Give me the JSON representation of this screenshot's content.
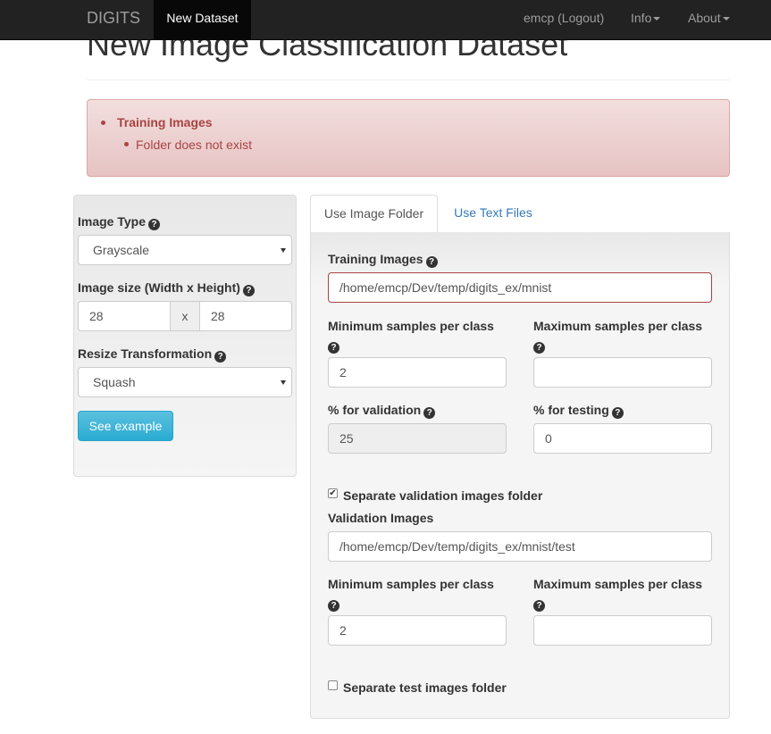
{
  "navbar": {
    "brand": "DIGITS",
    "active_item": "New Dataset",
    "user_link": "emcp (Logout)",
    "info_menu": "Info",
    "about_menu": "About"
  },
  "page": {
    "title": "New Image Classification Dataset"
  },
  "alert": {
    "field": "Training Images",
    "message": "Folder does not exist"
  },
  "left_panel": {
    "image_type_label": "Image Type",
    "image_type_value": "Grayscale",
    "image_size_label": "Image size (Width x Height)",
    "width": "28",
    "size_separator": "x",
    "height": "28",
    "resize_label": "Resize Transformation",
    "resize_value": "Squash",
    "see_example": "See example"
  },
  "tabs": [
    "Use Image Folder",
    "Use Text Files"
  ],
  "folder_form": {
    "training_images_label": "Training Images",
    "training_images_value": "/home/emcp/Dev/temp/digits_ex/mnist",
    "min_samples_label": "Minimum samples per class",
    "min_samples_value": "2",
    "max_samples_label": "Maximum samples per class",
    "max_samples_value": "",
    "validation_pct_label": "% for validation",
    "validation_pct_value": "25",
    "testing_pct_label": "% for testing",
    "testing_pct_value": "0",
    "separate_validation_label": "Separate validation images folder",
    "separate_validation_checked": true,
    "validation_images_label": "Validation Images",
    "validation_images_value": "/home/emcp/Dev/temp/digits_ex/mnist/test",
    "val_min_samples_label": "Minimum samples per class",
    "val_min_samples_value": "2",
    "val_max_samples_label": "Maximum samples per class",
    "val_max_samples_value": "",
    "separate_test_label": "Separate test images folder",
    "separate_test_checked": false
  },
  "icons": {
    "help": "question-circle-icon",
    "dropdown": "caret-down-icon",
    "select": "select-arrow-icon",
    "check": "checkmark-icon"
  },
  "colors": {
    "navbar_bg": "#222222",
    "alert_text": "#a94442",
    "alert_bg": "#f2dede",
    "link": "#337ab7",
    "button_info": "#5bc0de"
  }
}
